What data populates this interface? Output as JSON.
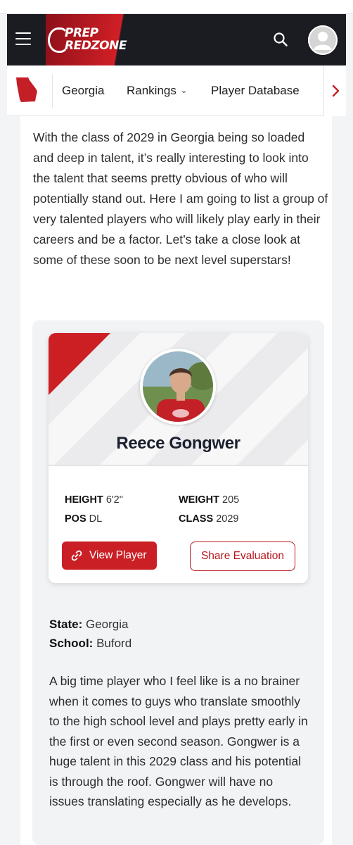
{
  "header": {
    "logo_line1": "PREP",
    "logo_line2": "REDZONE",
    "menu_icon": "hamburger-menu-icon",
    "search_icon": "search-icon",
    "avatar_icon": "user-avatar-icon"
  },
  "subnav": {
    "state_icon": "georgia-state-icon",
    "items": [
      {
        "label": "Georgia"
      },
      {
        "label": "Rankings"
      },
      {
        "label": "Player Database"
      }
    ],
    "next_icon": "chevron-right-icon"
  },
  "article": {
    "intro": "With the class of 2029 in Georgia being so loaded and deep in talent, it’s really interesting to look into the talent that seems pretty obvious of who will potentially stand out. Here I am going to list a group of very talented players who will likely play early in their careers and be a factor. Let’s take a close look at some of these soon to be next level superstars!"
  },
  "player": {
    "name": "Reece Gongwer",
    "stats": {
      "height_label": "HEIGHT",
      "height_value": "6'2\"",
      "weight_label": "WEIGHT",
      "weight_value": "205",
      "pos_label": "POS",
      "pos_value": "DL",
      "class_label": "CLASS",
      "class_value": "2029"
    },
    "view_button": "View Player",
    "share_button": "Share Evaluation",
    "state_label": "State:",
    "state_value": "Georgia",
    "school_label": "School:",
    "school_value": "Buford",
    "evaluation": "A big time player who I feel like is a no brainer when it comes to guys who translate smoothly to the high school level and plays pretty early in the first or even second season. Gongwer is a huge talent in this 2029 class and his potential is through the roof. Gongwer will have no issues translating especially as he develops."
  },
  "colors": {
    "brand_red": "#cc1f24",
    "header_dark": "#1b1c22"
  }
}
